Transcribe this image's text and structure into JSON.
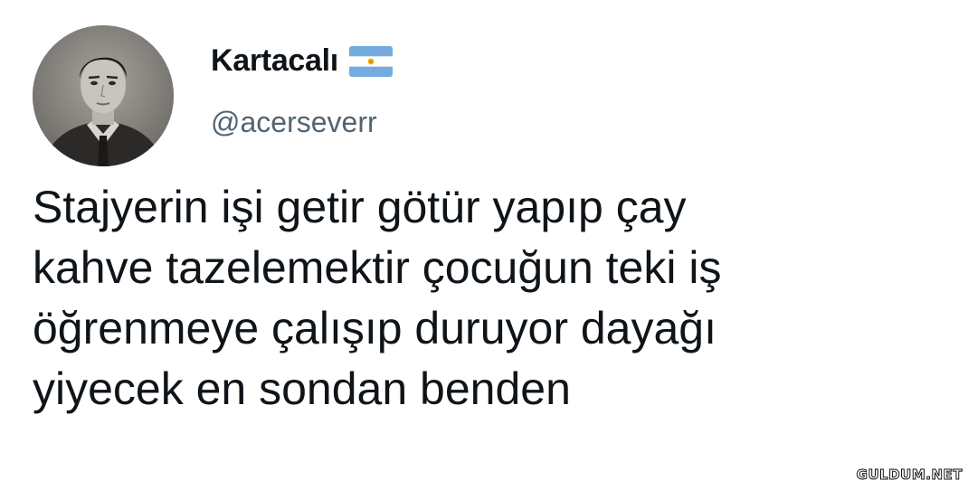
{
  "tweet": {
    "author": {
      "display_name": "Kartacalı",
      "handle": "@acerseverr",
      "flag_icon": "argentina-flag-icon",
      "avatar_icon": "vintage-portrait-avatar"
    },
    "text_lines": [
      "Stajyerin işi getir götür yapıp çay",
      "kahve tazelemektir çocuğun teki iş",
      "öğrenmeye çalışıp duruyor dayağı",
      "yiyecek en sondan benden"
    ]
  },
  "watermark": "GULDUM.NET",
  "colors": {
    "text": "#0f1419",
    "handle": "#536471",
    "flag_blue": "#74acdf",
    "flag_sun": "#f6b40e"
  }
}
